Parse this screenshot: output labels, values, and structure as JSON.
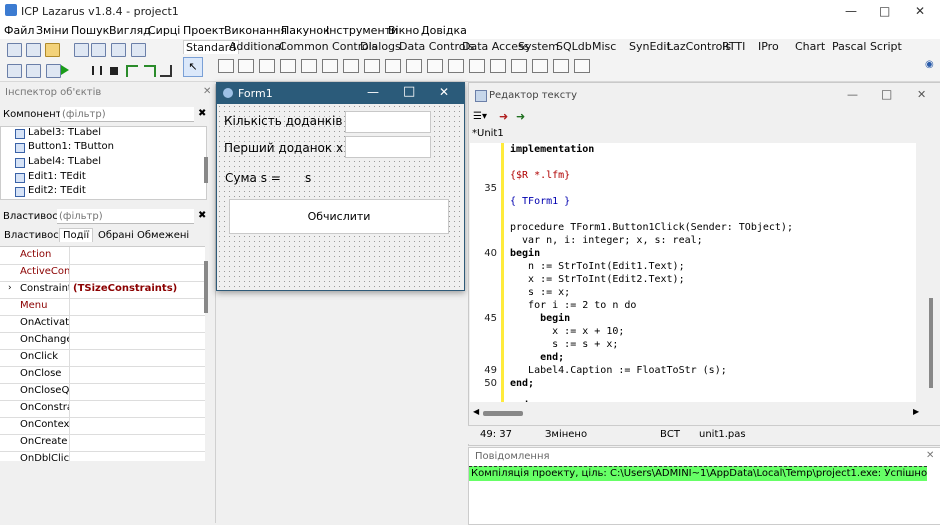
{
  "app": {
    "title": "ICP Lazarus v1.8.4 - project1"
  },
  "menu": [
    "Файл",
    "Зміни",
    "Пошук",
    "Вигляд",
    "Сирці",
    "Проект",
    "Виконання",
    "Пакунок",
    "Інструменти",
    "Вікно",
    "Довідка"
  ],
  "palette_tabs": [
    "Standard",
    "Additional",
    "Common Controls",
    "Dialogs",
    "Data Controls",
    "Data Access",
    "System",
    "SQLdb",
    "Misc",
    "SynEdit",
    "LazControls",
    "RTTI",
    "IPro",
    "Chart",
    "Pascal Script"
  ],
  "inspector": {
    "title": "Інспектор об'єктів",
    "components_label": "Компоненти",
    "components_filter_placeholder": "(фільтр)",
    "tree": [
      "Label3: TLabel",
      "Button1: TButton",
      "Label4: TLabel",
      "Edit1: TEdit",
      "Edit2: TEdit"
    ],
    "properties_label": "Властивості",
    "properties_filter_placeholder": "(фільтр)",
    "tabs": [
      "Властивості",
      "Події",
      "Обрані",
      "Обмежені"
    ],
    "active_tab": "Події",
    "rows": [
      {
        "name": "Action",
        "value": ""
      },
      {
        "name": "ActiveControl",
        "value": ""
      },
      {
        "name": "Constraints",
        "value": "(TSizeConstraints)"
      },
      {
        "name": "Menu",
        "value": ""
      },
      {
        "name": "OnActivate",
        "value": ""
      },
      {
        "name": "OnChangeBounds",
        "value": ""
      },
      {
        "name": "OnClick",
        "value": ""
      },
      {
        "name": "OnClose",
        "value": ""
      },
      {
        "name": "OnCloseQuery",
        "value": ""
      },
      {
        "name": "OnConstrainedResize",
        "value": ""
      },
      {
        "name": "OnContextPopup",
        "value": ""
      },
      {
        "name": "OnCreate",
        "value": ""
      },
      {
        "name": "OnDblClick",
        "value": ""
      }
    ]
  },
  "form1": {
    "title": "Form1",
    "label1": "Кількість доданків n",
    "label2": "Перший доданок x",
    "label3": "Сума s =",
    "label4": "s",
    "button": "Обчислити",
    "edit1": "",
    "edit2": ""
  },
  "editor": {
    "title": "Редактор тексту",
    "tab": "*Unit1",
    "lines": [
      {
        "n": "",
        "t": "implementation"
      },
      {
        "n": "",
        "t": ""
      },
      {
        "n": "",
        "t": "{$R *.lfm}"
      },
      {
        "n": "35",
        "t": ""
      },
      {
        "n": "",
        "t": "{ TForm1 }"
      },
      {
        "n": "",
        "t": ""
      },
      {
        "n": "",
        "t": "procedure TForm1.Button1Click(Sender: TObject);"
      },
      {
        "n": "",
        "t": "  var n, i: integer; x, s: real;"
      },
      {
        "n": "40",
        "t": "begin"
      },
      {
        "n": "",
        "t": "   n := StrToInt(Edit1.Text);"
      },
      {
        "n": "",
        "t": "   x := StrToInt(Edit2.Text);"
      },
      {
        "n": "",
        "t": "   s := x;"
      },
      {
        "n": "",
        "t": "   for i := 2 to n do"
      },
      {
        "n": "45",
        "t": "     begin"
      },
      {
        "n": "",
        "t": "       x := x + 10;"
      },
      {
        "n": "",
        "t": "       s := s + x;"
      },
      {
        "n": "",
        "t": "     end;"
      },
      {
        "n": "49",
        "t": "   Label4.Caption := FloatToStr (s);"
      },
      {
        "n": "50",
        "t": "end;"
      },
      {
        "n": "",
        "t": ""
      },
      {
        "n": "",
        "t": "end."
      }
    ],
    "status": {
      "pos": "49: 37",
      "modified": "Змінено",
      "ins": "ВСТ",
      "file": "unit1.pas"
    }
  },
  "messages": {
    "title": "Повідомлення",
    "text": "Компіляція проекту, ціль: C:\\Users\\ADMINI~1\\AppData\\Local\\Temp\\project1.exe: Успішно",
    "ok_color": "#66ff66"
  }
}
